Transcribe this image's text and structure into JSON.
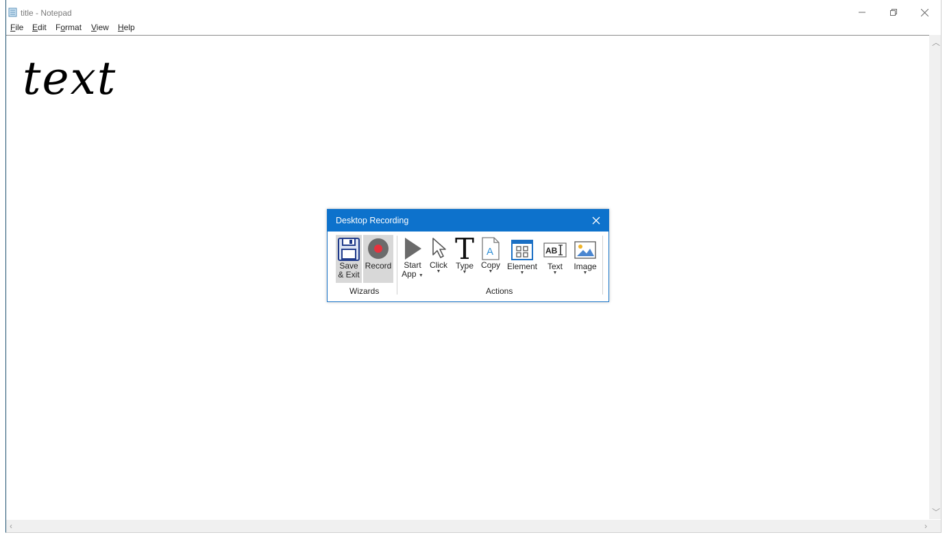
{
  "window": {
    "title": "title - Notepad",
    "menu": [
      {
        "label": "File",
        "underline": "F",
        "rest": "ile"
      },
      {
        "label": "Edit",
        "underline": "E",
        "rest": "dit"
      },
      {
        "label": "Format",
        "underline": "o",
        "pre": "F",
        "rest": "rmat"
      },
      {
        "label": "View",
        "underline": "V",
        "rest": "iew"
      },
      {
        "label": "Help",
        "underline": "H",
        "rest": "elp"
      }
    ]
  },
  "editor": {
    "content": "text"
  },
  "dialog": {
    "title": "Desktop Recording",
    "wizards": {
      "group_label": "Wizards",
      "save_exit_line1": "Save",
      "save_exit_line2": "& Exit",
      "record": "Record"
    },
    "actions": {
      "group_label": "Actions",
      "start_app_line1": "Start",
      "start_app_line2": "App",
      "click": "Click",
      "type": "Type",
      "copy": "Copy",
      "element": "Element",
      "text": "Text",
      "image": "Image",
      "text_icon_label": "AB"
    }
  },
  "colors": {
    "dialog_titlebar": "#0d72cc",
    "record_red": "#e8323d",
    "floppy_blue": "#1f3a8a"
  }
}
